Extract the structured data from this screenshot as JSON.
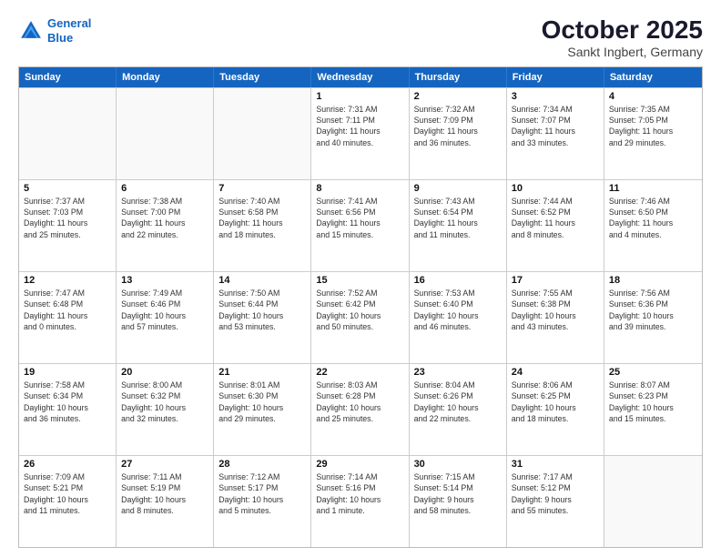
{
  "header": {
    "logo_line1": "General",
    "logo_line2": "Blue",
    "title": "October 2025",
    "subtitle": "Sankt Ingbert, Germany"
  },
  "weekdays": [
    "Sunday",
    "Monday",
    "Tuesday",
    "Wednesday",
    "Thursday",
    "Friday",
    "Saturday"
  ],
  "weeks": [
    [
      {
        "day": "",
        "detail": ""
      },
      {
        "day": "",
        "detail": ""
      },
      {
        "day": "",
        "detail": ""
      },
      {
        "day": "1",
        "detail": "Sunrise: 7:31 AM\nSunset: 7:11 PM\nDaylight: 11 hours\nand 40 minutes."
      },
      {
        "day": "2",
        "detail": "Sunrise: 7:32 AM\nSunset: 7:09 PM\nDaylight: 11 hours\nand 36 minutes."
      },
      {
        "day": "3",
        "detail": "Sunrise: 7:34 AM\nSunset: 7:07 PM\nDaylight: 11 hours\nand 33 minutes."
      },
      {
        "day": "4",
        "detail": "Sunrise: 7:35 AM\nSunset: 7:05 PM\nDaylight: 11 hours\nand 29 minutes."
      }
    ],
    [
      {
        "day": "5",
        "detail": "Sunrise: 7:37 AM\nSunset: 7:03 PM\nDaylight: 11 hours\nand 25 minutes."
      },
      {
        "day": "6",
        "detail": "Sunrise: 7:38 AM\nSunset: 7:00 PM\nDaylight: 11 hours\nand 22 minutes."
      },
      {
        "day": "7",
        "detail": "Sunrise: 7:40 AM\nSunset: 6:58 PM\nDaylight: 11 hours\nand 18 minutes."
      },
      {
        "day": "8",
        "detail": "Sunrise: 7:41 AM\nSunset: 6:56 PM\nDaylight: 11 hours\nand 15 minutes."
      },
      {
        "day": "9",
        "detail": "Sunrise: 7:43 AM\nSunset: 6:54 PM\nDaylight: 11 hours\nand 11 minutes."
      },
      {
        "day": "10",
        "detail": "Sunrise: 7:44 AM\nSunset: 6:52 PM\nDaylight: 11 hours\nand 8 minutes."
      },
      {
        "day": "11",
        "detail": "Sunrise: 7:46 AM\nSunset: 6:50 PM\nDaylight: 11 hours\nand 4 minutes."
      }
    ],
    [
      {
        "day": "12",
        "detail": "Sunrise: 7:47 AM\nSunset: 6:48 PM\nDaylight: 11 hours\nand 0 minutes."
      },
      {
        "day": "13",
        "detail": "Sunrise: 7:49 AM\nSunset: 6:46 PM\nDaylight: 10 hours\nand 57 minutes."
      },
      {
        "day": "14",
        "detail": "Sunrise: 7:50 AM\nSunset: 6:44 PM\nDaylight: 10 hours\nand 53 minutes."
      },
      {
        "day": "15",
        "detail": "Sunrise: 7:52 AM\nSunset: 6:42 PM\nDaylight: 10 hours\nand 50 minutes."
      },
      {
        "day": "16",
        "detail": "Sunrise: 7:53 AM\nSunset: 6:40 PM\nDaylight: 10 hours\nand 46 minutes."
      },
      {
        "day": "17",
        "detail": "Sunrise: 7:55 AM\nSunset: 6:38 PM\nDaylight: 10 hours\nand 43 minutes."
      },
      {
        "day": "18",
        "detail": "Sunrise: 7:56 AM\nSunset: 6:36 PM\nDaylight: 10 hours\nand 39 minutes."
      }
    ],
    [
      {
        "day": "19",
        "detail": "Sunrise: 7:58 AM\nSunset: 6:34 PM\nDaylight: 10 hours\nand 36 minutes."
      },
      {
        "day": "20",
        "detail": "Sunrise: 8:00 AM\nSunset: 6:32 PM\nDaylight: 10 hours\nand 32 minutes."
      },
      {
        "day": "21",
        "detail": "Sunrise: 8:01 AM\nSunset: 6:30 PM\nDaylight: 10 hours\nand 29 minutes."
      },
      {
        "day": "22",
        "detail": "Sunrise: 8:03 AM\nSunset: 6:28 PM\nDaylight: 10 hours\nand 25 minutes."
      },
      {
        "day": "23",
        "detail": "Sunrise: 8:04 AM\nSunset: 6:26 PM\nDaylight: 10 hours\nand 22 minutes."
      },
      {
        "day": "24",
        "detail": "Sunrise: 8:06 AM\nSunset: 6:25 PM\nDaylight: 10 hours\nand 18 minutes."
      },
      {
        "day": "25",
        "detail": "Sunrise: 8:07 AM\nSunset: 6:23 PM\nDaylight: 10 hours\nand 15 minutes."
      }
    ],
    [
      {
        "day": "26",
        "detail": "Sunrise: 7:09 AM\nSunset: 5:21 PM\nDaylight: 10 hours\nand 11 minutes."
      },
      {
        "day": "27",
        "detail": "Sunrise: 7:11 AM\nSunset: 5:19 PM\nDaylight: 10 hours\nand 8 minutes."
      },
      {
        "day": "28",
        "detail": "Sunrise: 7:12 AM\nSunset: 5:17 PM\nDaylight: 10 hours\nand 5 minutes."
      },
      {
        "day": "29",
        "detail": "Sunrise: 7:14 AM\nSunset: 5:16 PM\nDaylight: 10 hours\nand 1 minute."
      },
      {
        "day": "30",
        "detail": "Sunrise: 7:15 AM\nSunset: 5:14 PM\nDaylight: 9 hours\nand 58 minutes."
      },
      {
        "day": "31",
        "detail": "Sunrise: 7:17 AM\nSunset: 5:12 PM\nDaylight: 9 hours\nand 55 minutes."
      },
      {
        "day": "",
        "detail": ""
      }
    ]
  ]
}
